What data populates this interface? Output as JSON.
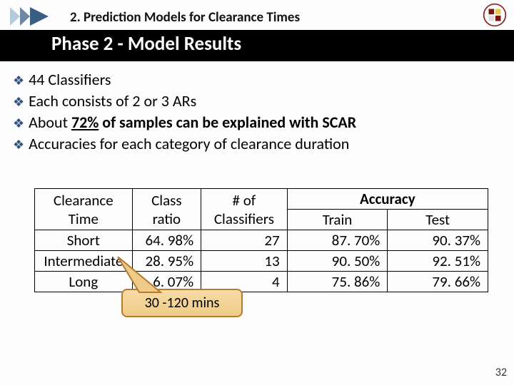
{
  "header": {
    "section_label": "2. Prediction Models for Clearance Times",
    "title": "Phase 2 - Model Results"
  },
  "bullets": [
    {
      "text": "44 Classifiers"
    },
    {
      "text": "Each consists of 2 or 3 ARs"
    },
    {
      "pre": "About ",
      "strong": "72%",
      "post": " of samples can be explained with SCAR"
    },
    {
      "text": "Accuracies for each category of clearance duration"
    }
  ],
  "table": {
    "head": {
      "clearance": "Clearance Time",
      "ratio": "Class ratio",
      "nof": "# of Classifiers",
      "accuracy": "Accuracy",
      "train": "Train",
      "test": "Test"
    },
    "rows": [
      {
        "clearance": "Short",
        "ratio": "64. 98%",
        "nof": "27",
        "train": "87. 70%",
        "test": "90. 37%"
      },
      {
        "clearance": "Intermediate",
        "ratio": "28. 95%",
        "nof": "13",
        "train": "90. 50%",
        "test": "92. 51%"
      },
      {
        "clearance": "Long",
        "ratio": "6. 07%",
        "nof": "4",
        "train": "75. 86%",
        "test": "79. 66%"
      }
    ]
  },
  "callout": "30 -120 mins",
  "page_number": "32"
}
